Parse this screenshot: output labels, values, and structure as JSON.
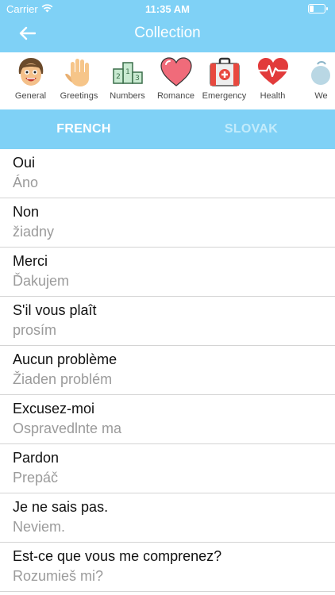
{
  "status": {
    "carrier": "Carrier",
    "time": "11:35 AM",
    "battery_level": 0.25
  },
  "nav": {
    "title": "Collection",
    "back_icon": "arrow-left-icon"
  },
  "categories": [
    {
      "label": "General",
      "icon": "face-icon"
    },
    {
      "label": "Greetings",
      "icon": "hand-icon"
    },
    {
      "label": "Numbers",
      "icon": "podium-icon"
    },
    {
      "label": "Romance",
      "icon": "heart-icon"
    },
    {
      "label": "Emergency",
      "icon": "first-aid-icon"
    },
    {
      "label": "Health",
      "icon": "heartbeat-icon"
    },
    {
      "label": "We",
      "icon": "partial-icon"
    }
  ],
  "languages": {
    "source": "FRENCH",
    "target": "SLOVAK"
  },
  "phrases": [
    {
      "phrase": "Oui",
      "translation": "Áno"
    },
    {
      "phrase": "Non",
      "translation": "žiadny"
    },
    {
      "phrase": "Merci",
      "translation": "Ďakujem"
    },
    {
      "phrase": "S'il vous plaît",
      "translation": "prosím"
    },
    {
      "phrase": "Aucun problème",
      "translation": "Žiaden problém"
    },
    {
      "phrase": "Excusez-moi",
      "translation": "Ospravedlnte ma"
    },
    {
      "phrase": "Pardon",
      "translation": "Prepáč"
    },
    {
      "phrase": "Je ne sais pas.",
      "translation": "Neviem."
    },
    {
      "phrase": "Est-ce que vous me comprenez?",
      "translation": "Rozumieš mi?"
    }
  ],
  "colors": {
    "accent": "#7fd1f6",
    "inactive_tab": "#c2ebfb"
  }
}
